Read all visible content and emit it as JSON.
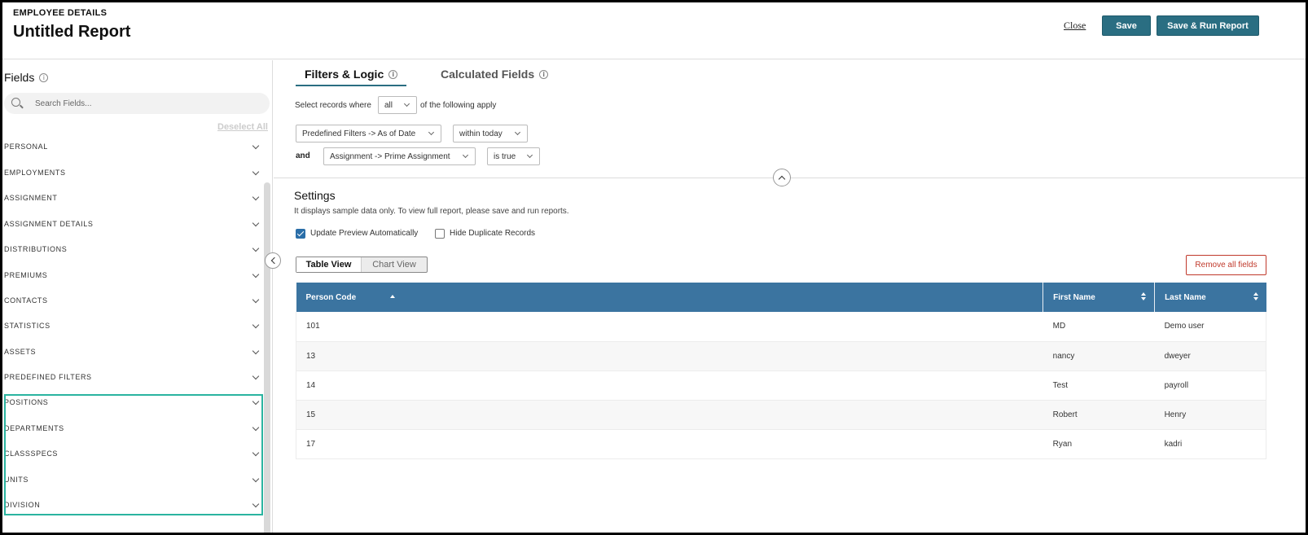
{
  "header": {
    "eyebrow": "EMPLOYEE DETAILS",
    "title": "Untitled Report",
    "close_label": "Close",
    "save_label": "Save",
    "save_run_label": "Save & Run Report",
    "accent_color": "#2a6e82"
  },
  "sidebar": {
    "title": "Fields",
    "search_placeholder": "Search Fields...",
    "deselect_label": "Deselect All",
    "items": [
      {
        "label": "PERSONAL"
      },
      {
        "label": "EMPLOYMENTS"
      },
      {
        "label": "ASSIGNMENT"
      },
      {
        "label": "ASSIGNMENT DETAILS"
      },
      {
        "label": "DISTRIBUTIONS"
      },
      {
        "label": "PREMIUMS"
      },
      {
        "label": "CONTACTS"
      },
      {
        "label": "STATISTICS"
      },
      {
        "label": "ASSETS"
      },
      {
        "label": "PREDEFINED FILTERS"
      },
      {
        "label": "POSITIONS"
      },
      {
        "label": "DEPARTMENTS"
      },
      {
        "label": "CLASSSPECS"
      },
      {
        "label": "UNITS"
      },
      {
        "label": "DIVISION"
      }
    ],
    "highlight_color": "#2ab4a0"
  },
  "tabs": {
    "filters_label": "Filters & Logic",
    "calculated_label": "Calculated Fields"
  },
  "filters": {
    "prefix": "Select records where",
    "match_value": "all",
    "suffix": "of the following apply",
    "and_label": "and",
    "rows": [
      {
        "field": "Predefined Filters -> As of Date",
        "operator": "within today"
      },
      {
        "field": "Assignment -> Prime Assignment",
        "operator": "is true"
      }
    ]
  },
  "settings": {
    "title": "Settings",
    "note": "It displays sample data only. To view full report, please save and run reports.",
    "update_preview_label": "Update Preview Automatically",
    "update_preview_checked": true,
    "hide_duplicates_label": "Hide Duplicate Records",
    "hide_duplicates_checked": false,
    "table_view_label": "Table View",
    "chart_view_label": "Chart View",
    "remove_all_label": "Remove all fields"
  },
  "table": {
    "header_color": "#3b74a0",
    "columns": [
      "Person Code",
      "First Name",
      "Last Name"
    ],
    "rows": [
      [
        "101",
        "MD",
        "Demo user"
      ],
      [
        "13",
        "nancy",
        "dweyer"
      ],
      [
        "14",
        "Test",
        "payroll"
      ],
      [
        "15",
        "Robert",
        "Henry"
      ],
      [
        "17",
        "Ryan",
        "kadri"
      ]
    ]
  }
}
